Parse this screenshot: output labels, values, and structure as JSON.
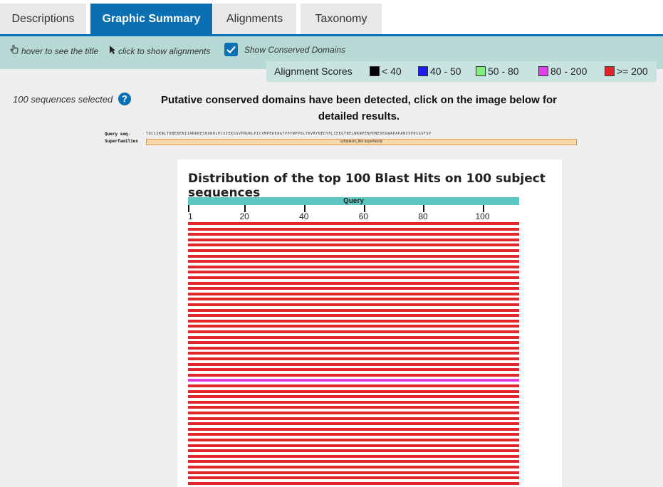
{
  "tabs": [
    {
      "label": "Descriptions",
      "active": false
    },
    {
      "label": "Graphic Summary",
      "active": true
    },
    {
      "label": "Alignments",
      "active": false
    },
    {
      "label": "Taxonomy",
      "active": false
    }
  ],
  "toolbar": {
    "hover_text": "hover to see the title",
    "click_text": "click to show alignments",
    "show_cdd_label": "Show Conserved Domains",
    "show_cdd_checked": true
  },
  "legend": {
    "label": "Alignment Scores",
    "items": [
      {
        "label": "< 40",
        "color": "#000000"
      },
      {
        "label": "40 - 50",
        "color": "#1c1cf0"
      },
      {
        "label": "50 - 80",
        "color": "#7ff07f"
      },
      {
        "label": "80 - 200",
        "color": "#e040e8"
      },
      {
        "label": ">= 200",
        "color": "#e0262b"
      }
    ]
  },
  "info": {
    "selected": "100 sequences selected",
    "cdd_message": "Putative conserved domains have been detected, click on the image below for detailed results."
  },
  "cdd_image": {
    "query_label": "Query seq.",
    "superfamily_label": "Superfamilies",
    "sequence": "TQCCIKNLTDNEKENIIANDRESHORDLPCSIEKGSVPRUKLPICVMPEKEAGTVPYNPPDLTKVRYNEDYPLIEKGYNELNKNPENPPNEVEGWAPAPANIVPDIGSFSP",
    "superfamily": "cytoplasm_like superfamily"
  },
  "graphic": {
    "title": "Distribution of the top 100 Blast Hits on 100 subject sequences",
    "query_label": "Query",
    "ruler_ticks": [
      {
        "value": 1,
        "label": "1"
      },
      {
        "value": 20,
        "label": "20"
      },
      {
        "value": 40,
        "label": "40"
      },
      {
        "value": 60,
        "label": "60"
      },
      {
        "value": 80,
        "label": "80"
      },
      {
        "value": 100,
        "label": "100"
      }
    ],
    "query_length": 111,
    "hits_visible": 49,
    "hit_color_default": "#e0262b",
    "special_hit_index": 29,
    "special_hit_color": "#e040e8"
  }
}
